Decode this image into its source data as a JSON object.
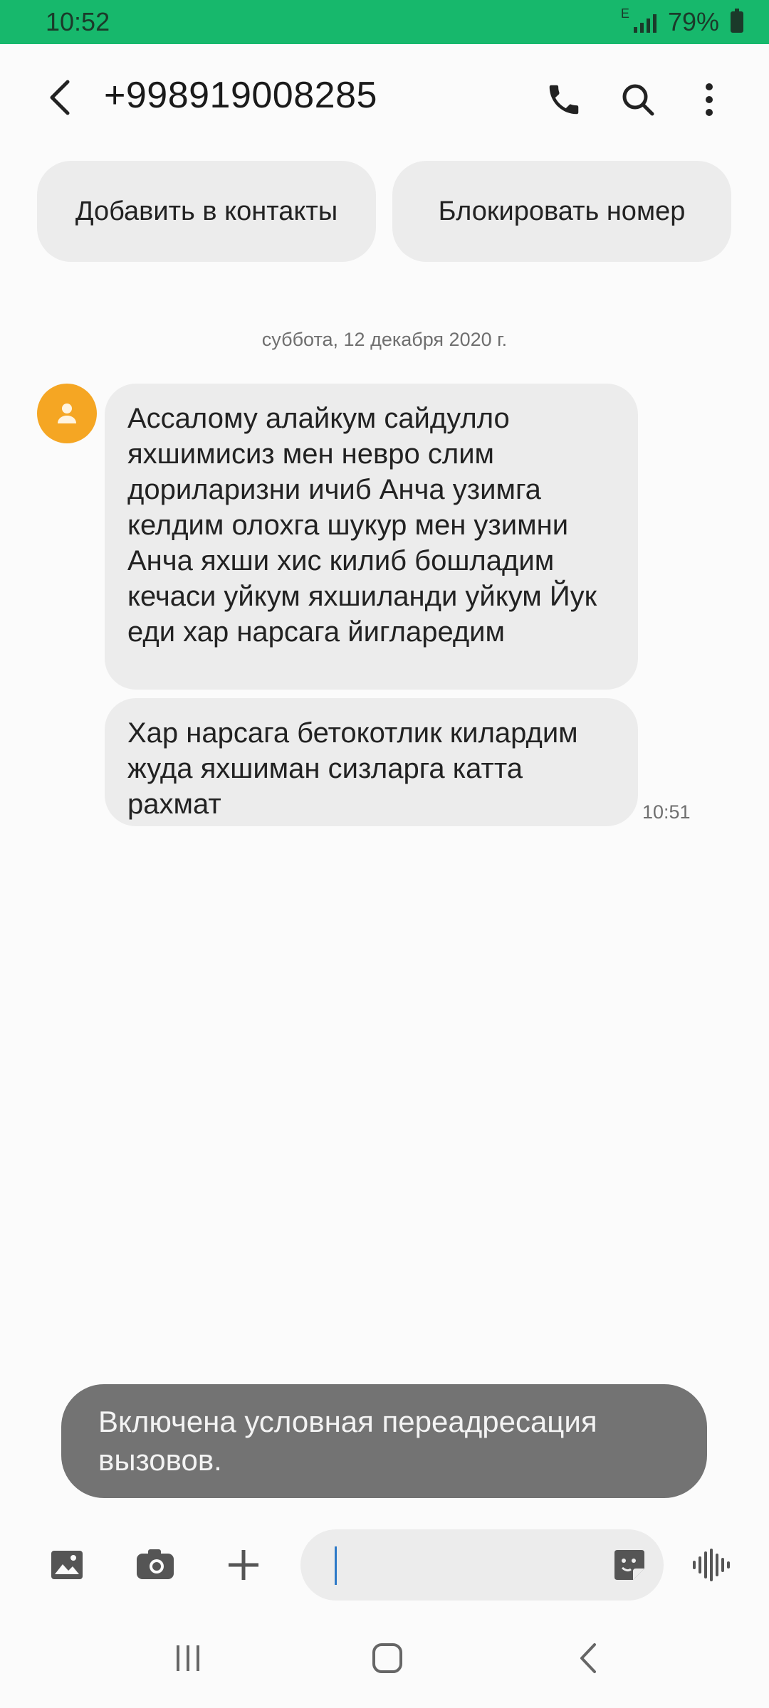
{
  "status_bar": {
    "time": "10:52",
    "network_type": "E",
    "battery_percent": "79%",
    "bg_color": "#17b86c",
    "signal_icon": "signal-icon",
    "battery_icon": "battery-icon"
  },
  "header": {
    "title": "+998919008285",
    "back_icon": "back-arrow-icon",
    "call_icon": "phone-icon",
    "search_icon": "search-icon",
    "more_icon": "more-vert-icon"
  },
  "actions": {
    "add_contact_label": "Добавить в контакты",
    "block_label": "Блокировать номер"
  },
  "conversation": {
    "date_separator": "суббота, 12 декабря 2020 г.",
    "avatar_color": "#f5a623",
    "messages": [
      {
        "text": "Ассалому алайкум сайдулло яхшимисиз мен невро слим дориларизни ичиб Анча узимга келдим олохга шукур мен узимни Анча яхши хис килиб бошладим кечаси уйкум яхшиланди уйкум Йук еди хар нарсага йигларедим"
      },
      {
        "text": "Хар нарсага бетокотлик килардим жуда яхшиман сизларга катта рахмат",
        "time": "10:51"
      }
    ]
  },
  "toast": {
    "text": "Включена условная переадресация вызовов."
  },
  "composer": {
    "gallery_icon": "gallery-icon",
    "camera_icon": "camera-icon",
    "attach_icon": "plus-icon",
    "sticker_icon": "sticker-icon",
    "voice_icon": "voice-wave-icon",
    "input_value": ""
  },
  "nav_bar": {
    "recents_icon": "recents-icon",
    "home_icon": "home-icon",
    "back_icon": "nav-back-icon"
  }
}
